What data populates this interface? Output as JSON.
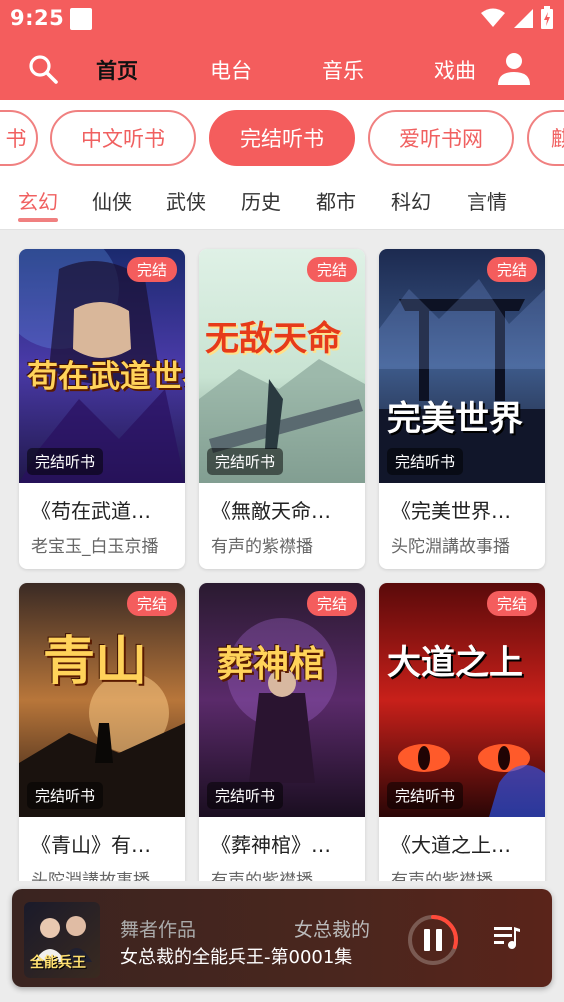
{
  "status": {
    "time": "9:25"
  },
  "nav": {
    "tabs": [
      "首页",
      "电台",
      "音乐",
      "戏曲"
    ],
    "active_color": "#111111",
    "bar_color": "#f45d5d"
  },
  "chips": [
    "书",
    "中文听书",
    "完结听书",
    "爱听书网",
    "麒"
  ],
  "categories": [
    "玄幻",
    "仙侠",
    "武侠",
    "历史",
    "都市",
    "科幻",
    "言情"
  ],
  "books": [
    {
      "cover_text": "苟在武道世界成圣",
      "badge": "完结",
      "tag": "完结听书",
      "name": "《苟在武道…",
      "author": "老宝玉_白玉京播"
    },
    {
      "cover_text": "无敌天命",
      "badge": "完结",
      "tag": "完结听书",
      "name": "《無敵天命…",
      "author": "有声的紫襟播"
    },
    {
      "cover_text": "完美世界",
      "badge": "完结",
      "tag": "完结听书",
      "name": "《完美世界…",
      "author": "头陀淵講故事播"
    },
    {
      "cover_text": "青山",
      "badge": "完结",
      "tag": "完结听书",
      "name": "《青山》有…",
      "author": "头陀淵講故事播"
    },
    {
      "cover_text": "葬神棺",
      "badge": "完结",
      "tag": "完结听书",
      "name": "《葬神棺》…",
      "author": "有声的紫襟播"
    },
    {
      "cover_text": "大道之上",
      "badge": "完结",
      "tag": "完结听书",
      "name": "《大道之上…",
      "author": "有声的紫襟播"
    }
  ],
  "player": {
    "line1a": "舞者作品",
    "line1b": "女总裁的",
    "line2": "女总裁的全能兵王-第0001集",
    "thumb_text": "全能兵王",
    "progress": 0.3
  }
}
